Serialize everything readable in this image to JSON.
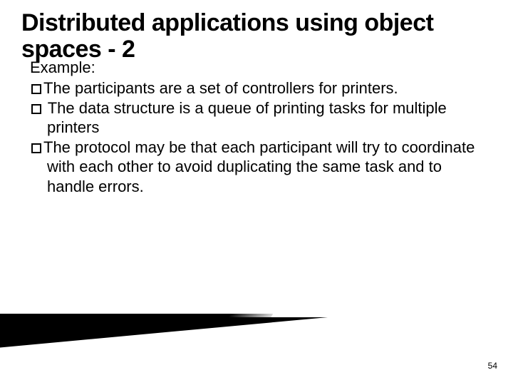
{
  "title": "Distributed applications using object spaces - 2",
  "example_label": "Example:",
  "bullets": [
    "The participants are a set of controllers for printers.",
    " The data structure is a queue of printing tasks for multiple printers",
    "The protocol may be that each participant will try to coordinate with each other to avoid duplicating the same task and to handle errors."
  ],
  "page_number": "54"
}
